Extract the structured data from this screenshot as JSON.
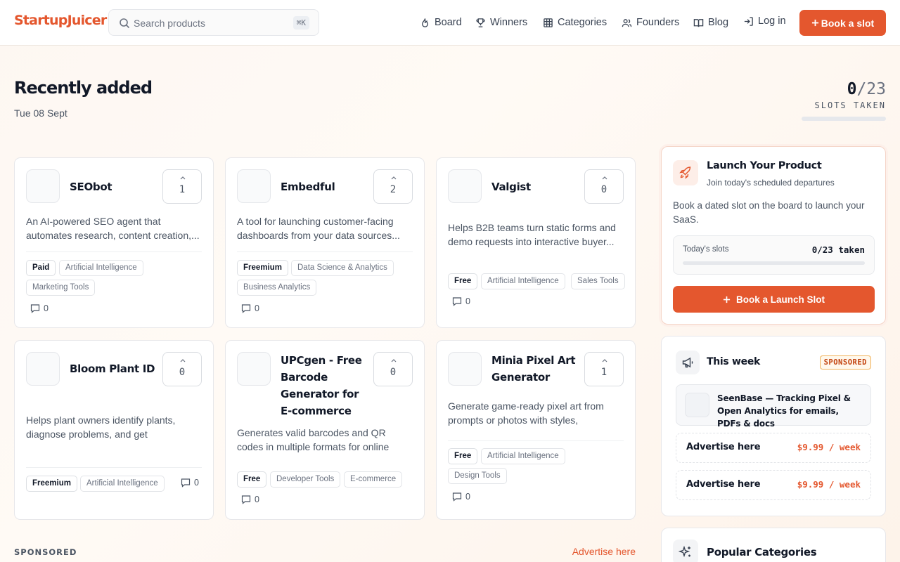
{
  "header": {
    "logo": "StartupJuicer",
    "search_placeholder": "Search products",
    "search_shortcut": "⌘K",
    "nav": [
      {
        "label": "Board",
        "icon": "flame-icon"
      },
      {
        "label": "Winners",
        "icon": "trophy-icon"
      },
      {
        "label": "Categories",
        "icon": "grid-icon"
      },
      {
        "label": "Founders",
        "icon": "users-icon"
      },
      {
        "label": "Blog",
        "icon": "book-icon"
      },
      {
        "label": "Log in",
        "icon": "login-icon"
      }
    ],
    "cta": "Book a slot"
  },
  "page": {
    "title": "Recently added",
    "date": "Tue 08 Sept",
    "slots_taken": "0",
    "slots_total": "/23",
    "slots_label": "SLOTS TAKEN",
    "slots_fraction": 0
  },
  "products": [
    {
      "name": "SEObot",
      "votes": "1",
      "desc": "An AI-powered SEO agent that automates research, content creation,...",
      "pricing": "Paid",
      "tags": [
        "Artificial Intelligence",
        "Marketing Tools"
      ],
      "comments": "0"
    },
    {
      "name": "Embedful",
      "votes": "2",
      "desc": "A tool for launching customer-facing dashboards from your data sources...",
      "pricing": "Freemium",
      "tags": [
        "Data Science & Analytics",
        "Business Analytics"
      ],
      "comments": "0"
    },
    {
      "name": "Valgist",
      "votes": "0",
      "desc": "Helps B2B teams turn static forms and demo requests into interactive buyer...",
      "pricing": "Free",
      "tags": [
        "Artificial Intelligence",
        "Sales Tools"
      ],
      "comments": "0"
    },
    {
      "name": "Bloom Plant ID",
      "votes": "0",
      "desc": "Helps plant owners identify plants, diagnose problems, and get personalize...",
      "pricing": "Freemium",
      "tags": [
        "Artificial Intelligence"
      ],
      "comments": "0"
    },
    {
      "name": "UPCgen - Free Barcode Generator for E-commerce",
      "votes": "0",
      "desc": "Generates valid barcodes and QR codes in multiple formats for online sellers and...",
      "pricing": "Free",
      "tags": [
        "Developer Tools",
        "E-commerce"
      ],
      "comments": "0"
    },
    {
      "name": "Minia Pixel Art Generator",
      "votes": "1",
      "desc": "Generate game-ready pixel art from prompts or photos with styles, batching,...",
      "pricing": "Free",
      "tags": [
        "Artificial Intelligence",
        "Design Tools"
      ],
      "comments": "0"
    }
  ],
  "sponsored_row": {
    "label": "SPONSORED",
    "link": "Advertise here"
  },
  "launch": {
    "title": "Launch Your Product",
    "subtitle": "Join today's scheduled departures",
    "desc": "Book a dated slot on the board to launch your SaaS.",
    "slots_label": "Today's slots",
    "slots_value": "0/23 taken",
    "button": "Book a Launch Slot"
  },
  "week": {
    "title": "This week",
    "badge": "SPONSORED",
    "sponsor_name": "SeenBase — Tracking Pixel & Open Analytics for emails, PDFs & docs",
    "ads": [
      {
        "text": "Advertise here",
        "price": "$9.99 / week"
      },
      {
        "text": "Advertise here",
        "price": "$9.99 / week"
      }
    ]
  },
  "categories": {
    "title": "Popular Categories"
  },
  "colors": {
    "accent": "#e4572e",
    "badge": "#f0b25a"
  }
}
